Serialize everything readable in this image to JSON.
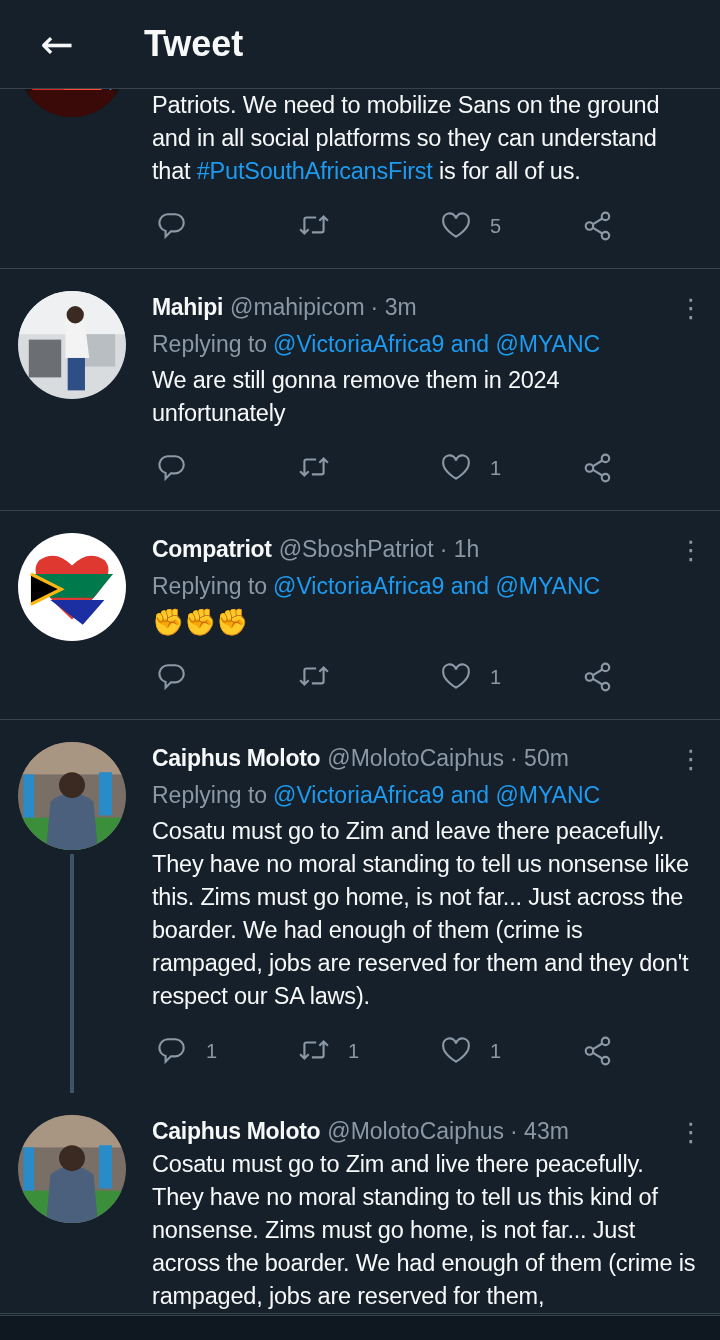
{
  "header": {
    "back": "←",
    "title": "Tweet"
  },
  "tweets": [
    {
      "avatar": {
        "kind": "picture"
      },
      "clipped_top": true,
      "body": [
        {
          "kind": "text",
          "text": "Patriots. We need to mobilize Sans on the ground and in all social platforms so they can understand that "
        },
        {
          "kind": "hashtag",
          "text": "#PutSouthAfricansFirst"
        },
        {
          "kind": "text",
          "text": " is for all of us."
        }
      ],
      "actions": [
        {
          "kind": "reply"
        },
        {
          "kind": "retweet"
        },
        {
          "kind": "like",
          "count": "5"
        },
        {
          "kind": "share"
        }
      ],
      "thread_line": false
    },
    {
      "avatar": {
        "kind": "picture"
      },
      "name": "Mahipi",
      "handle": "@mahipicom",
      "time": "· 3m",
      "more": "⋮",
      "replying_prefix": "Replying to",
      "replying_to": "@VictoriaAfrica9 and @MYANC",
      "body": [
        {
          "kind": "text",
          "text": "We are still gonna remove them in 2024 unfortunately"
        }
      ],
      "actions": [
        {
          "kind": "reply"
        },
        {
          "kind": "retweet"
        },
        {
          "kind": "like",
          "count": "1"
        },
        {
          "kind": "share"
        }
      ],
      "thread_line": false
    },
    {
      "avatar": {
        "kind": "picture"
      },
      "name": "Compatriot",
      "handle": "@SboshPatriot",
      "time": "· 1h",
      "more": "⋮",
      "replying_prefix": "Replying to",
      "replying_to": "@VictoriaAfrica9 and @MYANC",
      "body": [
        {
          "kind": "emoji",
          "text": "✊✊✊"
        }
      ],
      "actions": [
        {
          "kind": "reply"
        },
        {
          "kind": "retweet"
        },
        {
          "kind": "like",
          "count": "1"
        },
        {
          "kind": "share"
        }
      ],
      "thread_line": false
    },
    {
      "avatar": {
        "kind": "picture"
      },
      "name": "Caiphus Moloto",
      "handle": "@MolotoCaiphus",
      "time": "· 50m",
      "more": "⋮",
      "replying_prefix": "Replying to",
      "replying_to": "@VictoriaAfrica9 and @MYANC",
      "body": [
        {
          "kind": "text",
          "text": "Cosatu must go to Zim and leave there peacefully. They have no moral standing to tell us nonsense like this. Zims must go home, is not far... Just across the boarder. We had enough of them (crime is rampaged, jobs are reserved for them and they don't respect our SA laws)."
        }
      ],
      "actions": [
        {
          "kind": "reply",
          "count": "1"
        },
        {
          "kind": "retweet",
          "count": "1"
        },
        {
          "kind": "like",
          "count": "1"
        },
        {
          "kind": "share"
        }
      ],
      "thread_line": true
    },
    {
      "avatar": {
        "kind": "picture"
      },
      "name": "Caiphus Moloto",
      "handle": "@MolotoCaiphus",
      "time": "· 43m",
      "more": "⋮",
      "body": [
        {
          "kind": "text",
          "text": "Cosatu must go to Zim and live there peacefully. They have no moral standing to tell us this kind of nonsense. Zims must go home, is not far... Just across the boarder. We had enough of them (crime is rampaged, jobs are reserved for them,"
        }
      ],
      "thread_line": false
    }
  ]
}
